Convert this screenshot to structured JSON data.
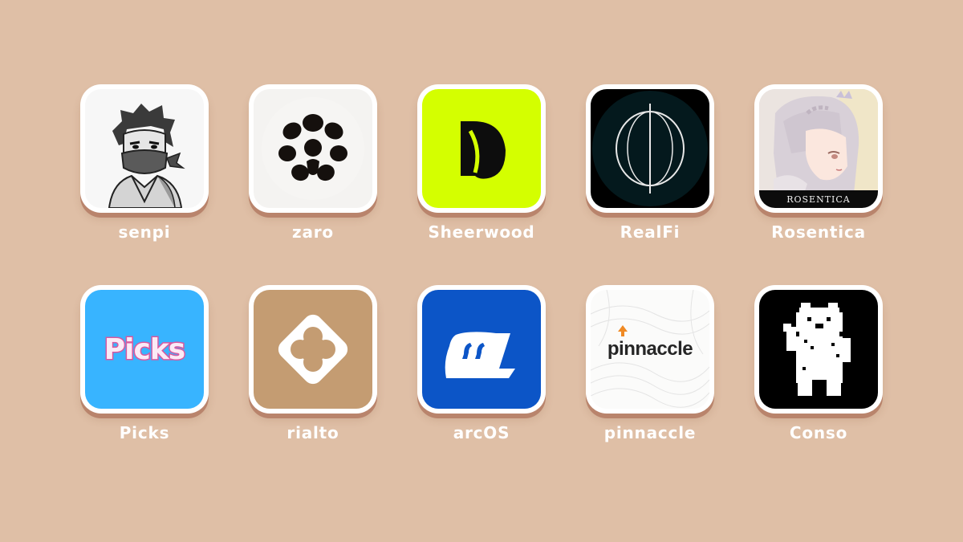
{
  "apps": [
    {
      "label": "senpi",
      "icon": "ninja-avatar-icon",
      "bg": "#f7f7f7"
    },
    {
      "label": "zaro",
      "icon": "flower-dots-icon",
      "bg": "#f4f3f1"
    },
    {
      "label": "Sheerwood",
      "icon": "d-letter-icon",
      "bg": "#d4ff00"
    },
    {
      "label": "RealFi",
      "icon": "phi-circle-icon",
      "bg": "#04191d"
    },
    {
      "label": "Rosentica",
      "icon": "anime-girl-icon",
      "bg": "#e9e1df",
      "logo_text": "ROSENTICA"
    },
    {
      "label": "Picks",
      "icon": "picks-logo-icon",
      "bg": "#38b4ff",
      "logo_text": "Picks"
    },
    {
      "label": "rialto",
      "icon": "diamond-clover-icon",
      "bg": "#c49c72"
    },
    {
      "label": "arcOS",
      "icon": "arc-quote-icon",
      "bg": "#0c55c7"
    },
    {
      "label": "pinnaccle",
      "icon": "pinnaccle-logo-icon",
      "bg": "#fbfbfa",
      "logo_text": "pinnaccle"
    },
    {
      "label": "Conso",
      "icon": "pixel-bear-icon",
      "bg": "#000000"
    }
  ]
}
